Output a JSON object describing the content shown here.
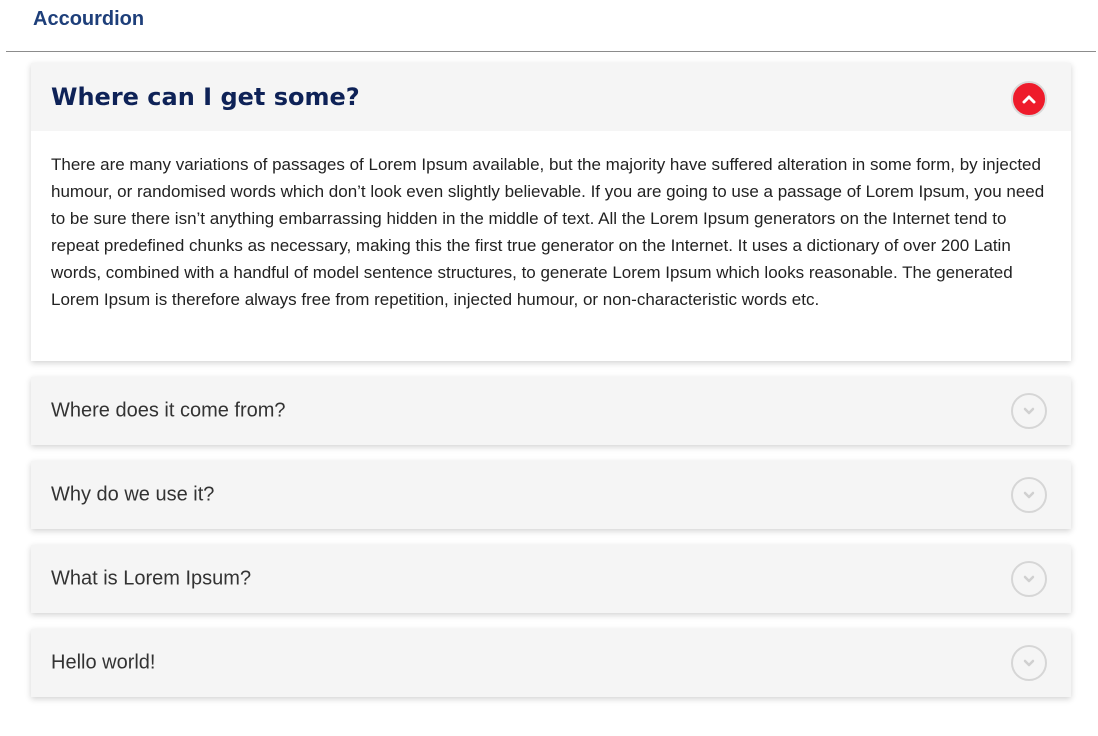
{
  "page": {
    "title": "Accourdion"
  },
  "accordion": {
    "items": [
      {
        "title": "Where can I get some?",
        "expanded": true,
        "body": "There are many variations of passages of Lorem Ipsum available, but the majority have suffered alteration in some form, by injected humour, or randomised words which don’t look even slightly believable. If you are going to use a passage of Lorem Ipsum, you need to be sure there isn’t anything embarrassing hidden in the middle of text. All the Lorem Ipsum generators on the Internet tend to repeat predefined chunks as necessary, making this the first true generator on the Internet. It uses a dictionary of over 200 Latin words, combined with a handful of model sentence structures, to generate Lorem Ipsum which looks reasonable. The generated Lorem Ipsum is therefore always free from repetition, injected humour, or non-characteristic words etc.",
        "icon": "chevron-up-icon"
      },
      {
        "title": "Where does it come from?",
        "expanded": false,
        "icon": "chevron-down-icon"
      },
      {
        "title": "Why do we use it?",
        "expanded": false,
        "icon": "chevron-down-icon"
      },
      {
        "title": "What is Lorem Ipsum?",
        "expanded": false,
        "icon": "chevron-down-icon"
      },
      {
        "title": "Hello world!",
        "expanded": false,
        "icon": "chevron-down-icon"
      }
    ]
  },
  "colors": {
    "page_title": "#1e3f7a",
    "open_title": "#0e2257",
    "open_toggle": "#ee1b2b",
    "panel_background": "#f5f5f5"
  }
}
